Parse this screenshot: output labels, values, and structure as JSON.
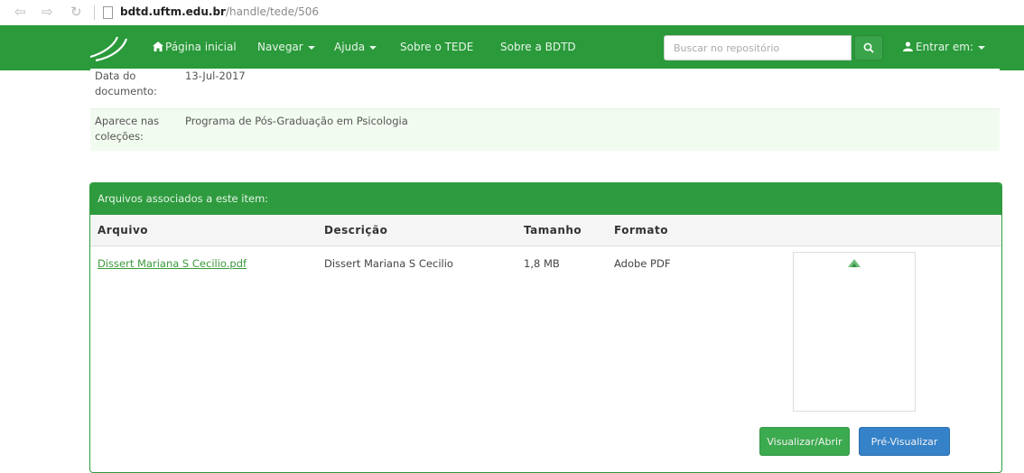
{
  "browser": {
    "url_host": "bdtd.uftm.edu.br",
    "url_path": "/handle/tede/506"
  },
  "navbar": {
    "home": "Página inicial",
    "browse": "Navegar",
    "help": "Ajuda",
    "about_tede": "Sobre o TEDE",
    "about_bdtd": "Sobre a BDTD",
    "search_placeholder": "Buscar no repositório",
    "login": "Entrar em:"
  },
  "metadata": [
    {
      "label": "Data do documento:",
      "value": "13-Jul-2017"
    },
    {
      "label": "Aparece nas coleções:",
      "value": "Programa de Pós-Graduação em Psicologia"
    }
  ],
  "files_panel": {
    "heading": "Arquivos associados a este item:",
    "columns": [
      "Arquivo",
      "Descrição",
      "Tamanho",
      "Formato"
    ],
    "rows": [
      {
        "file": "Dissert Mariana S Cecilio.pdf",
        "description": "Dissert Mariana S Cecilio",
        "size": "1,8 MB",
        "format": "Adobe PDF"
      }
    ],
    "open_button": "Visualizar/Abrir",
    "preview_button": "Pré-Visualizar"
  },
  "colors": {
    "navbar": "#2a9a3a",
    "panel": "#2e9b3e",
    "preview_button": "#3582c8",
    "open_button": "#3caa4f"
  }
}
